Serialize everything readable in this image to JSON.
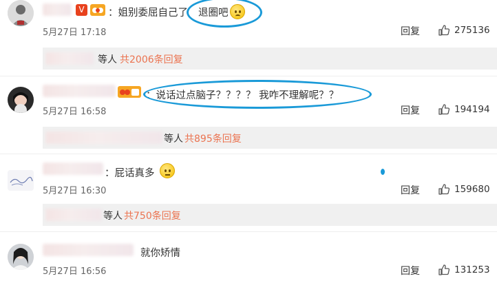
{
  "comments": [
    {
      "text": "姐别委屈自己了",
      "highlight": "退圈吧",
      "time": "5月27日 17:18",
      "reply_label": "回复",
      "likes": "275136",
      "sub_replies": {
        "hidden": "等人",
        "link": "共2006条回复"
      }
    },
    {
      "text": "说话过点脑子？？？？ 我咋不理解呢？？",
      "time": "5月27日 16:58",
      "reply_label": "回复",
      "likes": "194194",
      "sub_replies": {
        "hidden": "等人",
        "link": "共895条回复"
      }
    },
    {
      "text": "屁话真多",
      "time": "5月27日 16:30",
      "reply_label": "回复",
      "likes": "159680",
      "sub_replies": {
        "hidden": "等人",
        "link": "共750条回复"
      }
    },
    {
      "text": "就你矫情",
      "time": "5月27日 16:56",
      "reply_label": "回复",
      "likes": "131253"
    }
  ],
  "badges": {
    "vip": "V"
  },
  "colors": {
    "link": "#eb7350",
    "highlight_circle": "#1a9ad8",
    "vip_badge": "#e8411d",
    "gold_badge": "#f6a623"
  },
  "icons": {
    "like": "thumbs-up-icon",
    "emoji": "face-emoji-icon"
  }
}
